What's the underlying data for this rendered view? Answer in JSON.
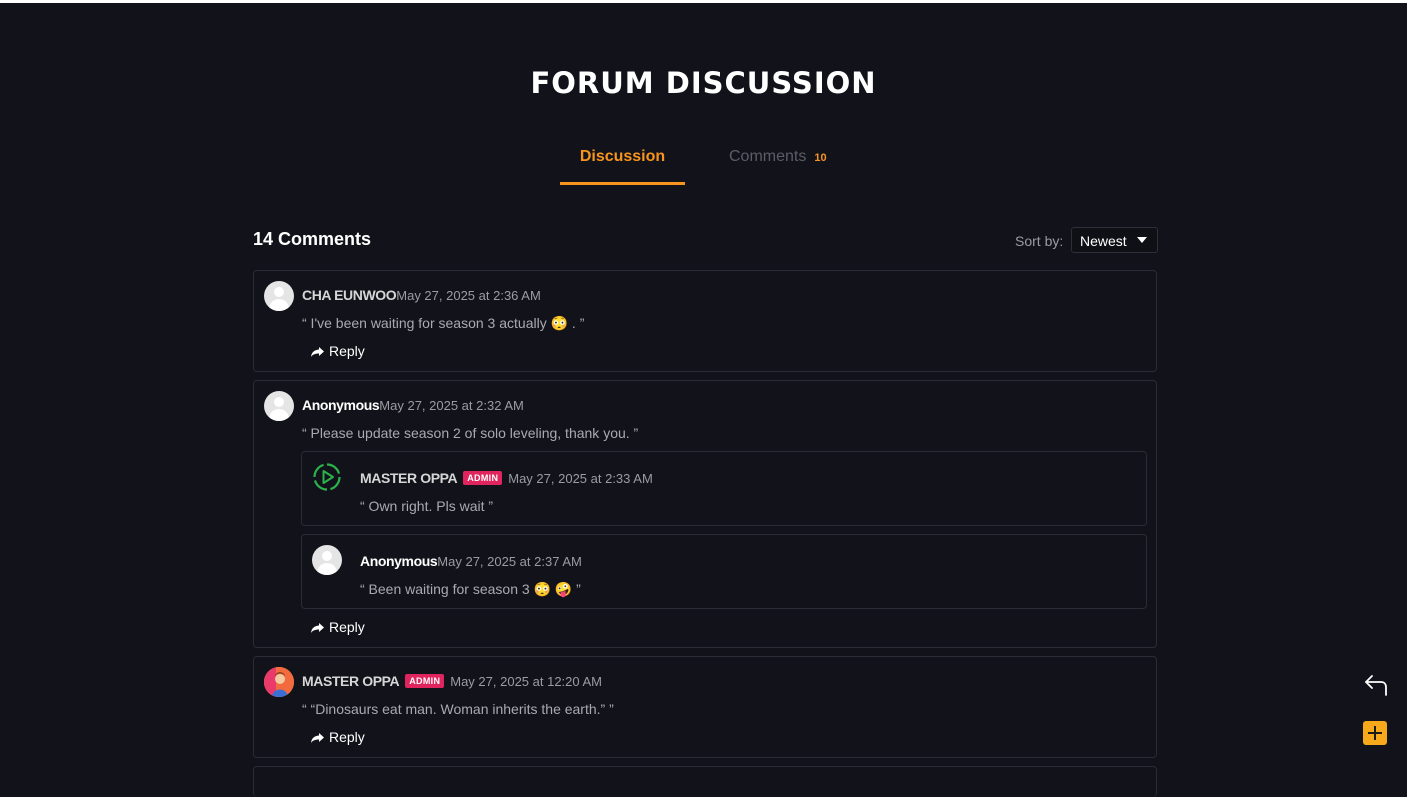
{
  "page": {
    "title": "FORUM DISCUSSION"
  },
  "tabs": [
    {
      "label": "Discussion",
      "active": true
    },
    {
      "label": "Comments",
      "count": "10",
      "active": false
    }
  ],
  "comments_header": {
    "count_label": "14 Comments",
    "sort_label": "Sort by:",
    "sort_value": "Newest"
  },
  "reply_label": "Reply",
  "comments": [
    {
      "author": "CHA EUNWOO",
      "date": "May 27, 2025 at 2:36 AM",
      "text": "“ I've been waiting for season 3 actually 😳 . ”"
    },
    {
      "author": "Anonymous",
      "date": "May 27, 2025 at 2:32 AM",
      "text": "“ Please update season 2 of solo leveling, thank you. ”",
      "replies": [
        {
          "author": "MASTER OPPA",
          "badge": "ADMIN",
          "date": "May 27, 2025 at 2:33 AM",
          "text": "“ Own right. Pls wait ”"
        },
        {
          "author": "Anonymous",
          "date": "May 27, 2025 at 2:37 AM",
          "text": "“ Been waiting for season 3 😳 🤪 ”"
        }
      ]
    },
    {
      "author": "MASTER OPPA",
      "badge": "ADMIN",
      "date": "May 27, 2025 at 12:20 AM",
      "text": "“ “Dinosaurs eat man. Woman inherits the earth.” ”"
    }
  ],
  "colors": {
    "accent": "#f7941d",
    "admin_badge": "#e0245e",
    "background": "#12131a"
  },
  "icons": {
    "back": "corner-up-left-icon",
    "add": "plus-icon",
    "reply": "share-arrow-icon",
    "admin_avatar": "play-circle-icon"
  }
}
